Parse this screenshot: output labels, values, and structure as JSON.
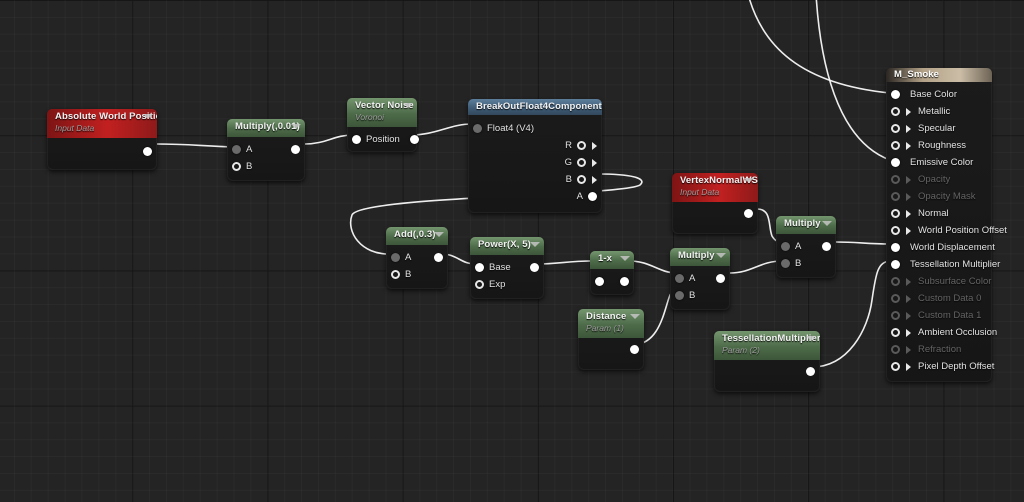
{
  "editor": {
    "name": "material-graph-editor",
    "background_color": "#242424",
    "wire_color": "#ffffff"
  },
  "nodes": {
    "absolute_world_position": {
      "title": "Absolute World Position",
      "subtitle": "Input Data",
      "header_color": "#c22020",
      "outputs": [
        ""
      ]
    },
    "multiply_001": {
      "title": "Multiply(,0.01)",
      "header_color": "#4d6b49",
      "inputs": [
        "A",
        "B"
      ],
      "outputs": [
        ""
      ]
    },
    "vector_noise": {
      "title": "Vector Noise",
      "subtitle": "Voronoi",
      "header_color": "#4d6b49",
      "inputs": [
        "Position"
      ],
      "outputs": [
        ""
      ]
    },
    "breakout_float4": {
      "title": "BreakOutFloat4Components",
      "header_color": "#3e5a73",
      "inputs": [
        "Float4 (V4)"
      ],
      "outputs": [
        "R",
        "G",
        "B",
        "A"
      ]
    },
    "add_03": {
      "title": "Add(,0.3)",
      "header_color": "#4d6b49",
      "inputs": [
        "A",
        "B"
      ],
      "outputs": [
        ""
      ]
    },
    "power_x5": {
      "title": "Power(X, 5)",
      "header_color": "#4d6b49",
      "inputs": [
        "Base",
        "Exp"
      ],
      "outputs": [
        ""
      ]
    },
    "one_minus_x": {
      "title": "1-x",
      "header_color": "#4d6b49",
      "inputs": [
        ""
      ],
      "outputs": [
        ""
      ]
    },
    "multiply_mid": {
      "title": "Multiply",
      "header_color": "#4d6b49",
      "inputs": [
        "A",
        "B"
      ],
      "outputs": [
        ""
      ]
    },
    "vertex_normal_ws": {
      "title": "VertexNormalWS",
      "subtitle": "Input Data",
      "header_color": "#c22020",
      "outputs": [
        ""
      ]
    },
    "multiply_right": {
      "title": "Multiply",
      "header_color": "#4d6b49",
      "inputs": [
        "A",
        "B"
      ],
      "outputs": [
        ""
      ]
    },
    "distance_param": {
      "title": "Distance",
      "subtitle": "Param (1)",
      "header_color": "#4d6b49",
      "outputs": [
        ""
      ]
    },
    "tessellation_param": {
      "title": "TessellationMultiplier",
      "subtitle": "Param (2)",
      "header_color": "#4d6b49",
      "outputs": [
        ""
      ]
    },
    "material_output": {
      "title": "M_Smoke",
      "header_color": "#cbbda6",
      "inputs": [
        {
          "label": "Base Color",
          "connected": true,
          "enabled": true
        },
        {
          "label": "Metallic",
          "connected": false,
          "enabled": true
        },
        {
          "label": "Specular",
          "connected": false,
          "enabled": true
        },
        {
          "label": "Roughness",
          "connected": false,
          "enabled": true
        },
        {
          "label": "Emissive Color",
          "connected": true,
          "enabled": true
        },
        {
          "label": "Opacity",
          "connected": false,
          "enabled": false
        },
        {
          "label": "Opacity Mask",
          "connected": false,
          "enabled": false
        },
        {
          "label": "Normal",
          "connected": false,
          "enabled": true
        },
        {
          "label": "World Position Offset",
          "connected": false,
          "enabled": true
        },
        {
          "label": "World Displacement",
          "connected": true,
          "enabled": true
        },
        {
          "label": "Tessellation Multiplier",
          "connected": true,
          "enabled": true
        },
        {
          "label": "Subsurface Color",
          "connected": false,
          "enabled": false
        },
        {
          "label": "Custom Data 0",
          "connected": false,
          "enabled": false
        },
        {
          "label": "Custom Data 1",
          "connected": false,
          "enabled": false
        },
        {
          "label": "Ambient Occlusion",
          "connected": false,
          "enabled": true
        },
        {
          "label": "Refraction",
          "connected": false,
          "enabled": false
        },
        {
          "label": "Pixel Depth Offset",
          "connected": false,
          "enabled": true
        }
      ]
    }
  }
}
